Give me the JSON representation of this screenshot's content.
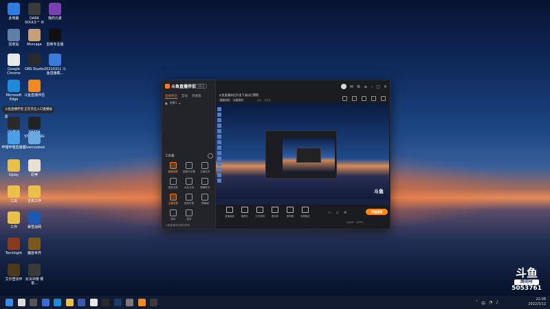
{
  "desktop_icons": [
    {
      "label": "此电脑",
      "icon": "computer-icon",
      "color": "#2f7de0"
    },
    {
      "label": "DARK SOULS™ III",
      "icon": "dark-souls-icon",
      "color": "#3a3a3a"
    },
    {
      "label": "我的元素",
      "icon": "app-icon",
      "color": "#7a3fb0"
    },
    {
      "label": "回收站",
      "icon": "recycle-bin-icon",
      "color": "#5f7ea8"
    },
    {
      "label": "Morcage",
      "icon": "avatar-app-icon",
      "color": "#c8a078"
    },
    {
      "label": "剪映专业版",
      "icon": "capcut-icon",
      "color": "#111111"
    },
    {
      "label": "Google Chrome",
      "icon": "chrome-icon",
      "color": "#e8e8e8"
    },
    {
      "label": "OBS Studio",
      "icon": "obs-icon",
      "color": "#2a2a2a"
    },
    {
      "label": "20220311 斗鱼直播截...",
      "icon": "document-icon",
      "color": "#3a7ad8"
    },
    {
      "label": "Microsoft Edge",
      "icon": "edge-icon",
      "color": "#1f8ad8"
    },
    {
      "label": "斗鱼直播伴侣",
      "icon": "douyu-companion-icon",
      "color": "#f08a24"
    },
    {
      "label": "QQ影音",
      "icon": "qq-player-icon",
      "color": "#2a2a2a"
    },
    {
      "label": "DEATH STRANDING",
      "icon": "death-stranding-icon",
      "color": "#222222"
    },
    {
      "label": "哔哩哔哩直播姬",
      "icon": "bilibili-live-icon",
      "color": "#4aa0e8"
    },
    {
      "label": "Overcooked",
      "icon": "overcooked-icon",
      "color": "#6aa8e0"
    },
    {
      "label": "Uplay",
      "icon": "folder-icon",
      "color": "#e8c04a"
    },
    {
      "label": "原神",
      "icon": "genshin-icon",
      "color": "#e8e0d0"
    },
    {
      "label": "工具",
      "icon": "folder-icon",
      "color": "#e8c04a"
    },
    {
      "label": "主机工作",
      "icon": "folder-icon",
      "color": "#e8c04a"
    },
    {
      "label": "工作",
      "icon": "folder-icon",
      "color": "#e8c04a"
    },
    {
      "label": "暴雪战网",
      "icon": "battlenet-icon",
      "color": "#1a5ab0"
    },
    {
      "label": "Torchlight",
      "icon": "torchlight-icon",
      "color": "#8a3a1a"
    },
    {
      "label": "魔兽世界",
      "icon": "wow-icon",
      "color": "#7a5a1a"
    },
    {
      "label": "艾尔登法环",
      "icon": "elden-ring-icon",
      "color": "#4a3a1a"
    },
    {
      "label": "对决冲榜 赛季...",
      "icon": "game-icon",
      "color": "#3a3a3a"
    }
  ],
  "notification": {
    "text": "斗鱼直播伴侣 正在开启入口直播画面"
  },
  "app": {
    "logo": "斗鱼直播伴侣",
    "version": "V5.3",
    "tabs": [
      "直播预览",
      "互动",
      "开发版"
    ],
    "scene": "场景1",
    "tools_title": "工具箱",
    "tools": [
      {
        "label": "直播录屏",
        "highlight": true
      },
      {
        "label": "摄像头设置",
        "highlight": false
      },
      {
        "label": "主播任务",
        "highlight": false
      },
      {
        "label": "语音连麦",
        "highlight": false
      },
      {
        "label": "水友互动",
        "highlight": false
      },
      {
        "label": "弹幕助手",
        "highlight": false
      },
      {
        "label": "主播答题",
        "highlight": true
      },
      {
        "label": "虚拟形象",
        "highlight": false
      },
      {
        "label": "弹幕墙",
        "highlight": false
      },
      {
        "label": "音效",
        "highlight": false
      },
      {
        "label": "更多",
        "highlight": false
      }
    ],
    "bottom_text": "斗鱼直播伴侣使用说明",
    "room": {
      "title": "斗鱼直播伴侣开发下测试用本",
      "badge": "测试",
      "tags": [
        "直播分类",
        "斗鱼测试"
      ],
      "meta": "分区 · 测试区"
    },
    "controls": [
      "直播画面",
      "摄像头",
      "文字说明",
      "麦克风",
      "扬声器",
      "音频输出"
    ],
    "start_button": "开始直播",
    "footer": "1080P · 30FPS"
  },
  "preview": {
    "logo": "斗鱼"
  },
  "watermark": {
    "logo": "斗鱼",
    "label": "房间号",
    "room_number": "5053761"
  },
  "taskbar": {
    "icons": [
      "windows-icon",
      "search-icon",
      "task-view-icon",
      "widgets-icon",
      "edge-icon",
      "explorer-icon",
      "store-icon",
      "chrome-icon",
      "obs-icon",
      "steam-icon",
      "app-icon",
      "douyu-icon",
      "game-icon"
    ],
    "ime": "中",
    "time": "22:08",
    "date": "2022/3/12"
  }
}
